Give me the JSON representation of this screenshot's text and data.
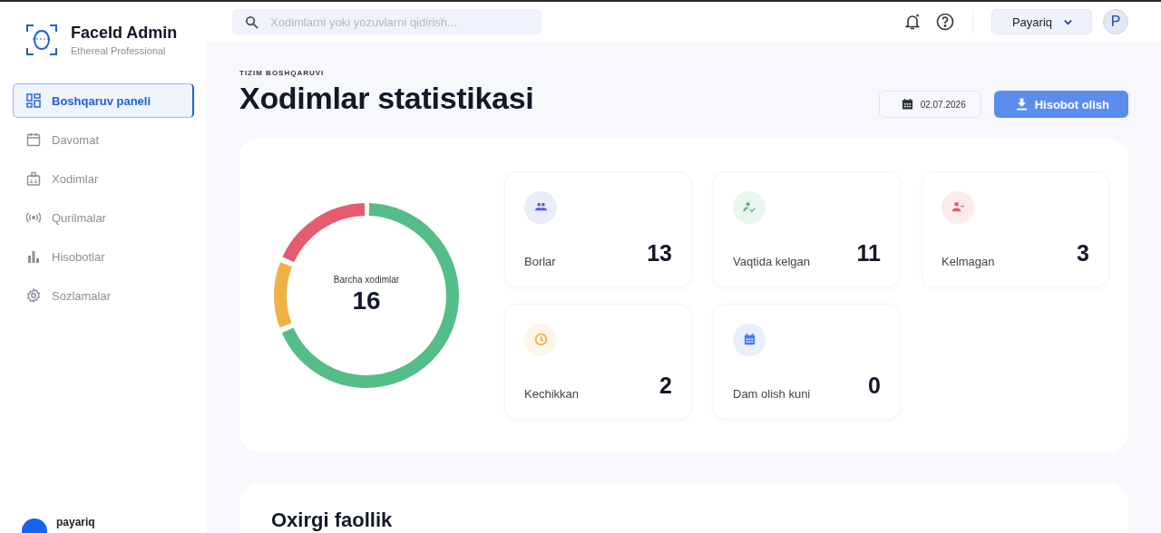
{
  "brand": {
    "title": "FaceId Admin",
    "subtitle": "Ethereal Professional"
  },
  "sidebar": {
    "items": [
      {
        "label": "Boshqaruv paneli",
        "kind": "grid",
        "selected": true
      },
      {
        "label": "Davomat",
        "kind": "calendar",
        "selected": false
      },
      {
        "label": "Xodimlar",
        "kind": "badge",
        "selected": false
      },
      {
        "label": "Qurilmalar",
        "kind": "signal",
        "selected": false
      },
      {
        "label": "Hisobotlar",
        "kind": "chart",
        "selected": false
      },
      {
        "label": "Sozlamalar",
        "kind": "gear",
        "selected": false
      }
    ],
    "user": {
      "name": "payariq"
    }
  },
  "search": {
    "placeholder": "Xodimlarni yoki yozuvlarni qidirish..."
  },
  "header": {
    "notification_dot": true,
    "org": "Payariq",
    "avatar": "P"
  },
  "page": {
    "eyebrow": "TIZIM BOSHQARUVI",
    "title": "Xodimlar statistikasi",
    "date": "02.07.2026",
    "report_button": "Hisobot olish"
  },
  "donut": {
    "label": "Barcha xodimlar",
    "total": "16"
  },
  "stats": [
    {
      "label": "Borlar",
      "value": "13",
      "kind": "people",
      "color": "#5b5fe0"
    },
    {
      "label": "Vaqtida kelgan",
      "value": "11",
      "kind": "check",
      "color": "#55bd87"
    },
    {
      "label": "Kelmagan",
      "value": "3",
      "kind": "minus",
      "color": "#e55c6e"
    },
    {
      "label": "Kechikkan",
      "value": "2",
      "kind": "clock",
      "color": "#f0b247"
    },
    {
      "label": "Dam olish kuni",
      "value": "0",
      "kind": "calendar",
      "color": "#4a7ae8"
    }
  ],
  "activity": {
    "title": "Oxirgi faollik"
  }
}
